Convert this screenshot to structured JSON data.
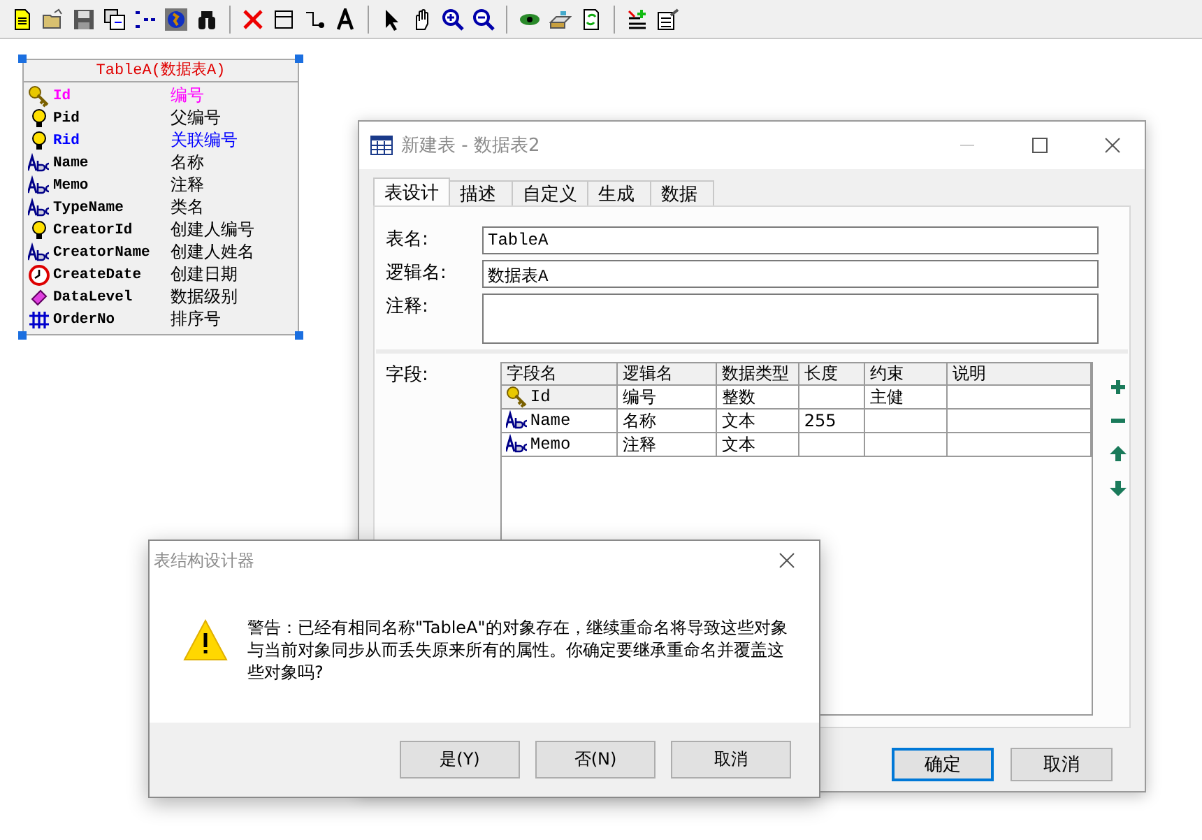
{
  "entity": {
    "title": "TableA(数据表A)",
    "selected": true,
    "fields": [
      {
        "kind": "key",
        "name": "Id",
        "label": "编号",
        "color": "#ff00ff"
      },
      {
        "kind": "bulb",
        "name": "Pid",
        "label": "父编号",
        "color": "#000000"
      },
      {
        "kind": "bulb",
        "name": "Rid",
        "label": "关联编号",
        "color": "#0000ff"
      },
      {
        "kind": "text",
        "name": "Name",
        "label": "名称",
        "color": "#000000"
      },
      {
        "kind": "text",
        "name": "Memo",
        "label": "注释",
        "color": "#000000"
      },
      {
        "kind": "text",
        "name": "TypeName",
        "label": "类名",
        "color": "#000000"
      },
      {
        "kind": "bulb",
        "name": "CreatorId",
        "label": "创建人编号",
        "color": "#000000"
      },
      {
        "kind": "text",
        "name": "CreatorName",
        "label": "创建人姓名",
        "color": "#000000"
      },
      {
        "kind": "date",
        "name": "CreateDate",
        "label": "创建日期",
        "color": "#000000"
      },
      {
        "kind": "tag",
        "name": "DataLevel",
        "label": "数据级别",
        "color": "#000000"
      },
      {
        "kind": "number",
        "name": "OrderNo",
        "label": "排序号",
        "color": "#000000"
      }
    ]
  },
  "design_window": {
    "title": "新建表 - 数据表2",
    "tabs": [
      {
        "label": "表设计",
        "selected": true
      },
      {
        "label": "描述",
        "selected": false
      },
      {
        "label": "自定义",
        "selected": false
      },
      {
        "label": "生成",
        "selected": false
      },
      {
        "label": "数据",
        "selected": false
      }
    ],
    "form": [
      {
        "kind": "line",
        "label": "表名:",
        "value": "TableA"
      },
      {
        "kind": "line",
        "label": "逻辑名:",
        "value": "数据表A"
      },
      {
        "kind": "area",
        "label": "注释:"
      }
    ],
    "fields_label": "字段:",
    "columns": [
      "字段名",
      "逻辑名",
      "数据类型",
      "长度",
      "约束",
      "说明"
    ],
    "rows": [
      {
        "kind": "key",
        "cells": [
          "Id",
          "编号",
          "整数",
          null,
          "主健",
          null
        ]
      },
      {
        "kind": "text",
        "cells": [
          "Name",
          "名称",
          "文本",
          "255",
          null,
          null
        ]
      },
      {
        "kind": "text",
        "cells": [
          "Memo",
          "注释",
          "文本",
          null,
          null,
          null
        ]
      }
    ],
    "buttons": [
      {
        "label": "确定",
        "default": true
      },
      {
        "label": "取消",
        "default": false
      }
    ]
  },
  "dialog": {
    "title": "表结构设计器",
    "message": "警告：已经有相同名称\"TableA\"的对象存在，继续重命名将导致这些对象与当前对象同步从而丢失原来所有的属性。你确定要继承重命名并覆盖这些对象吗?",
    "buttons": [
      "是(Y)",
      "否(N)",
      "取消"
    ]
  }
}
